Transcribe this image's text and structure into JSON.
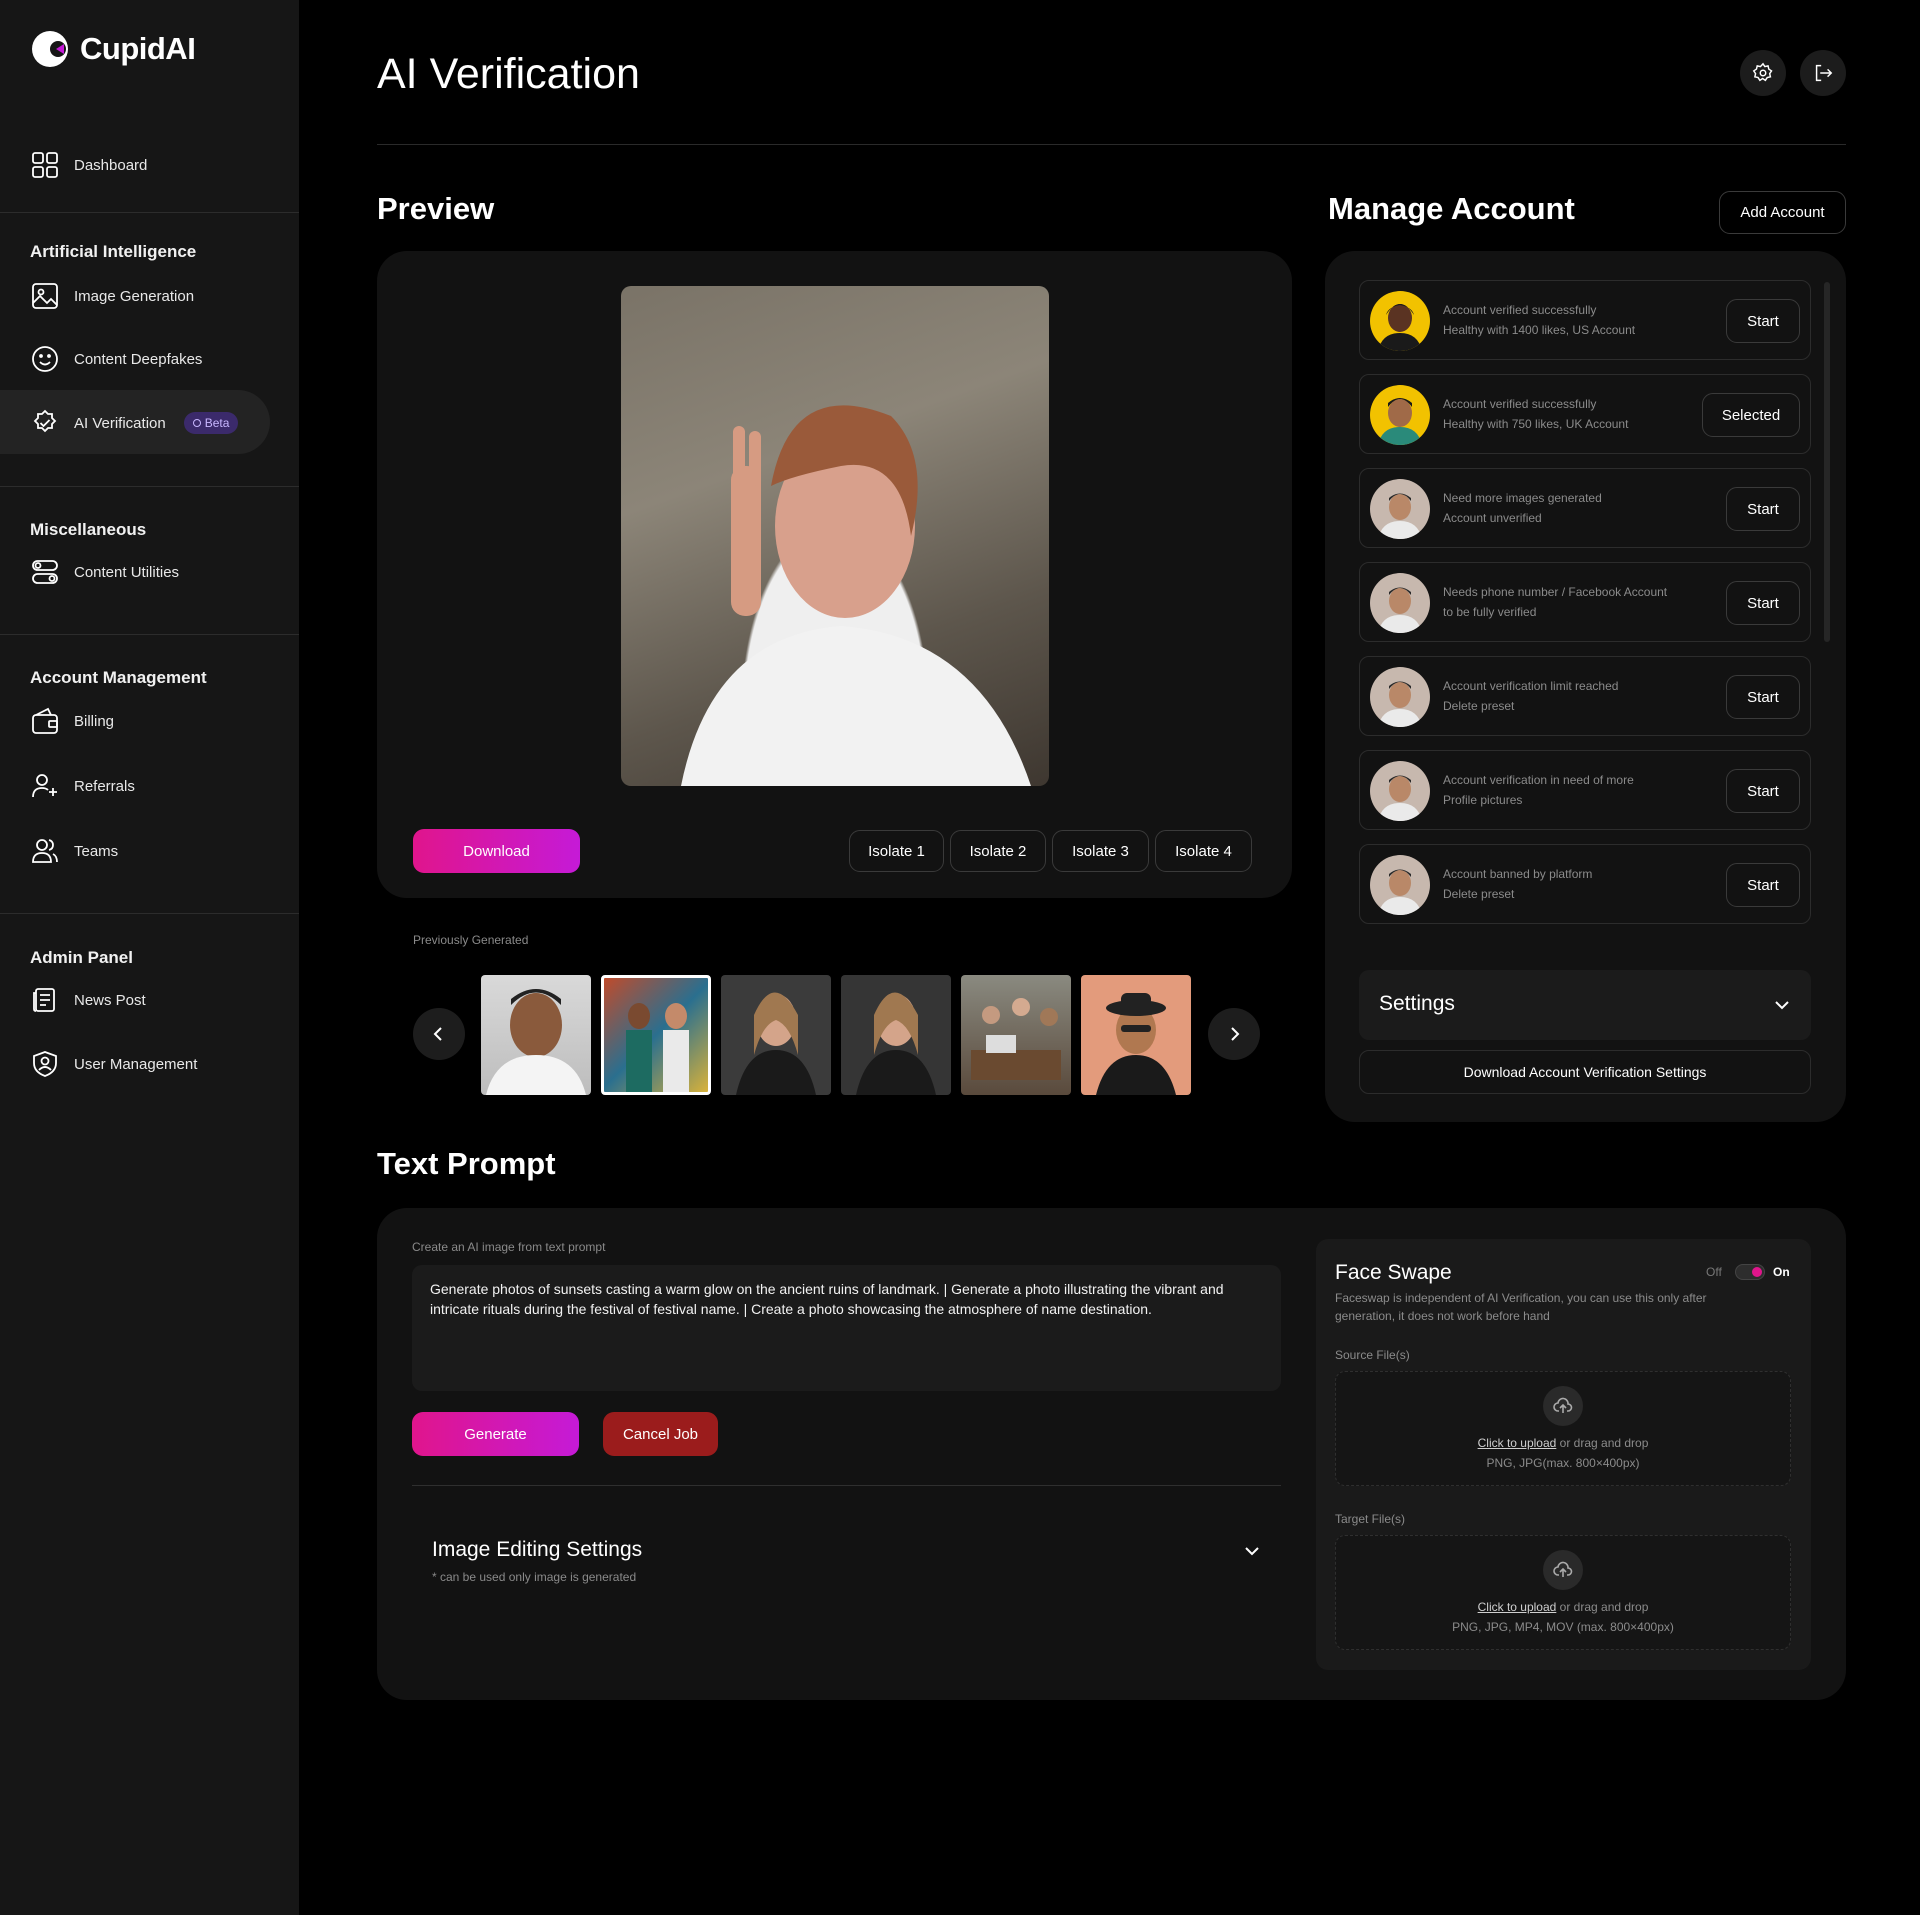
{
  "brand": {
    "name": "CupidAI"
  },
  "sidebar": {
    "dashboard": "Dashboard",
    "sections": [
      {
        "title": "Artificial Intelligence",
        "items": [
          "Image Generation",
          "Content Deepfakes",
          "AI Verification"
        ]
      },
      {
        "title": "Miscellaneous",
        "items": [
          "Content Utilities"
        ]
      },
      {
        "title": "Account Management",
        "items": [
          "Billing",
          "Referrals",
          "Teams"
        ]
      },
      {
        "title": "Admin Panel",
        "items": [
          "News Post",
          "User Management"
        ]
      }
    ],
    "beta_badge": "Beta",
    "active_item": "AI Verification"
  },
  "header": {
    "title": "AI Verification",
    "icons": [
      "settings-icon",
      "logout-icon"
    ]
  },
  "preview": {
    "title": "Preview",
    "download_label": "Download",
    "isolate_buttons": [
      "Isolate 1",
      "Isolate 2",
      "Isolate 3",
      "Isolate 4"
    ],
    "previously_generated_label": "Previously Generated",
    "thumbnail_count_visible": 6,
    "selected_thumbnail_index": 1
  },
  "manage_account": {
    "title": "Manage Account",
    "add_button": "Add Account",
    "accounts": [
      {
        "line1": "Account verified successfully",
        "line2": "Healthy with 1400 likes, US Account",
        "action": "Start"
      },
      {
        "line1": "Account verified successfully",
        "line2": "Healthy with 750 likes, UK Account",
        "action": "Selected"
      },
      {
        "line1": "Need more images generated",
        "line2": "Account unverified",
        "action": "Start"
      },
      {
        "line1": "Needs phone number / Facebook Account",
        "line2": "to be fully verified",
        "action": "Start"
      },
      {
        "line1": "Account verification limit reached",
        "line2": "Delete preset",
        "action": "Start"
      },
      {
        "line1": "Account verification in need of more",
        "line2": "Profile pictures",
        "action": "Start"
      },
      {
        "line1": "Account banned by platform",
        "line2": "Delete preset",
        "action": "Start"
      }
    ],
    "settings_label": "Settings",
    "download_settings_label": "Download Account Verification Settings"
  },
  "text_prompt": {
    "title": "Text Prompt",
    "label": "Create an AI image from text prompt",
    "value": "Generate photos of sunsets casting a warm glow on the ancient ruins of  landmark. | Generate a photo illustrating the vibrant and intricate rituals during the festival of festival name. | Create a photo showcasing the atmosphere of name destination.",
    "generate_label": "Generate",
    "cancel_label": "Cancel Job",
    "editing_settings_title": "Image Editing Settings",
    "editing_settings_note": "* can be used only image is generated"
  },
  "face_swap": {
    "title": "Face Swape",
    "toggle_off": "Off",
    "toggle_on": "On",
    "toggle_state": "on",
    "description": "Faceswap is independent of AI Verification, you can use this only after generation, it does not work before hand",
    "source_label": "Source File(s)",
    "source_formats": "PNG, JPG(max. 800×400px)",
    "target_label": "Target File(s)",
    "target_formats": "PNG, JPG, MP4, MOV (max. 800×400px)",
    "upload_link": "Click to upload",
    "upload_rest": " or drag and drop"
  },
  "colors": {
    "accent_start": "#e0158c",
    "accent_end": "#c51ad7",
    "cancel": "#9b1c1c",
    "beta_bg": "#3b2a6b"
  }
}
